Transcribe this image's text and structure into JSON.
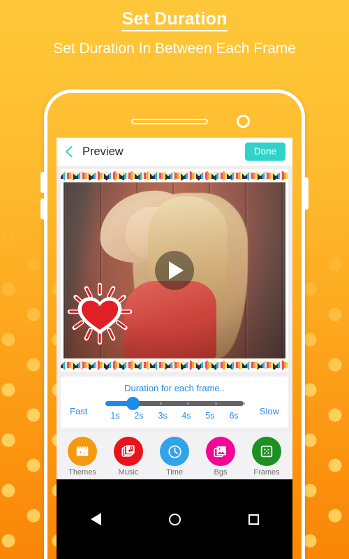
{
  "promo": {
    "title": "Set Duration",
    "subtitle": "Set Duration In Between Each Frame",
    "bg_color_top": "#FEC739",
    "bg_color_bottom": "#FA8707"
  },
  "app_bar": {
    "back_icon": "chevron-left-icon",
    "title": "Preview",
    "done_label": "Done",
    "done_color": "#2fd3cb",
    "back_icon_color": "#2fd3cb"
  },
  "preview": {
    "frame_style": "colorful-chevron-zigzag",
    "play_icon": "play-icon",
    "sticker": "heart-sticker",
    "photo_description": "Blonde woman in red top leaning against red barn wood wall"
  },
  "duration": {
    "caption": "Duration for each frame..",
    "fast_label": "Fast",
    "slow_label": "Slow",
    "selected_value": "2s",
    "ticks": [
      "1s",
      "2s",
      "3s",
      "4s",
      "5s",
      "6s"
    ],
    "track_color": "#646464",
    "fill_color": "#1e8ae8",
    "text_color": "#2a8bea"
  },
  "toolbar": {
    "items": [
      {
        "label": "Themes",
        "icon": "clapperboard-icon",
        "color": "#F59A10"
      },
      {
        "label": "Music",
        "icon": "music-note-icon",
        "color": "#E8131B"
      },
      {
        "label": "Time",
        "icon": "clock-icon",
        "color": "#32A3E8"
      },
      {
        "label": "Bgs",
        "icon": "image-stack-icon",
        "color": "#F20895"
      },
      {
        "label": "Frames",
        "icon": "frame-grid-icon",
        "color": "#1D9022"
      }
    ]
  },
  "nav_bar": {
    "back": "back-triangle-icon",
    "home": "home-circle-icon",
    "recents": "recents-square-icon"
  }
}
